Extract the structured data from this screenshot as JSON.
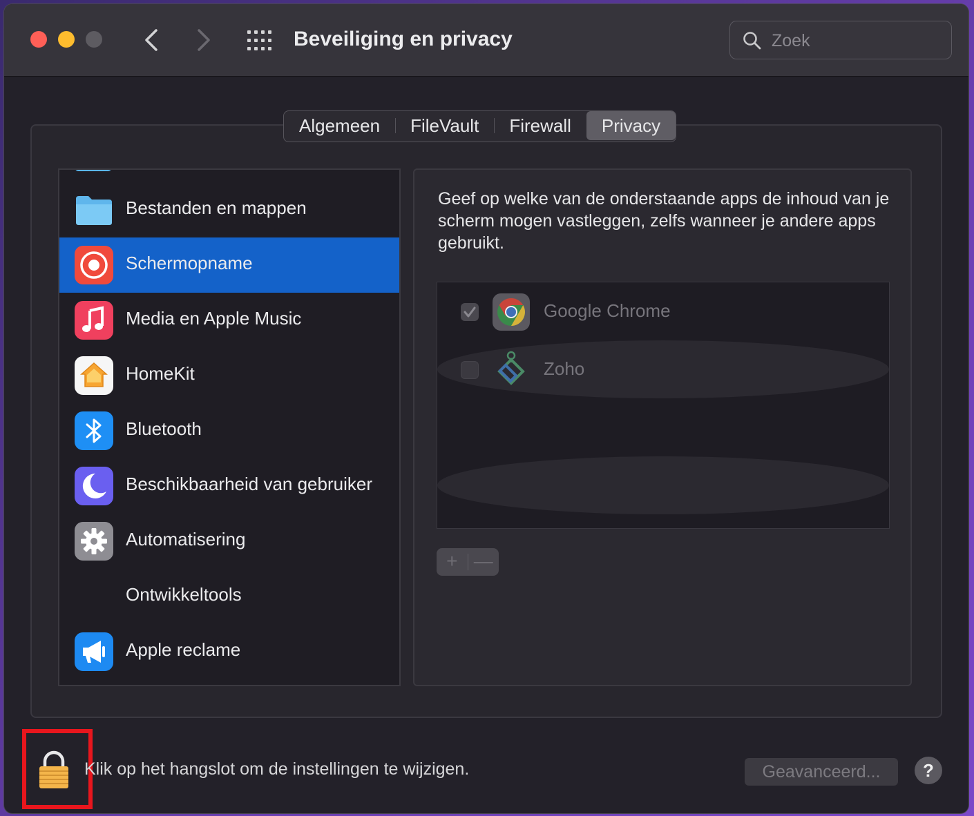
{
  "window": {
    "title": "Beveiliging en privacy",
    "search_placeholder": "Zoek"
  },
  "tabs": [
    {
      "label": "Algemeen",
      "active": false
    },
    {
      "label": "FileVault",
      "active": false
    },
    {
      "label": "Firewall",
      "active": false
    },
    {
      "label": "Privacy",
      "active": true
    }
  ],
  "sidebar": {
    "items": [
      {
        "label": "Bestanden en mappen",
        "icon": "folder-icon",
        "selected": false
      },
      {
        "label": "Schermopname",
        "icon": "screen-recording-icon",
        "selected": true
      },
      {
        "label": "Media en Apple Music",
        "icon": "music-note-icon",
        "selected": false
      },
      {
        "label": "HomeKit",
        "icon": "home-icon",
        "selected": false
      },
      {
        "label": "Bluetooth",
        "icon": "bluetooth-icon",
        "selected": false
      },
      {
        "label": "Beschikbaarheid van gebruiker",
        "icon": "moon-icon",
        "selected": false
      },
      {
        "label": "Automatisering",
        "icon": "gear-icon",
        "selected": false
      },
      {
        "label": "Ontwikkeltools",
        "icon": "",
        "selected": false
      },
      {
        "label": "Apple reclame",
        "icon": "megaphone-icon",
        "selected": false
      }
    ]
  },
  "detail": {
    "description": "Geef op welke van de onderstaande apps de inhoud van je scherm mogen vastleggen, zelfs wanneer je andere apps gebruikt.",
    "apps": [
      {
        "name": "Google Chrome",
        "checked": true,
        "icon": "chrome-icon"
      },
      {
        "name": "Zoho",
        "checked": false,
        "icon": "zoho-icon"
      }
    ],
    "add_label": "+",
    "remove_label": "—"
  },
  "footer": {
    "lock_text": "Klik op het hangslot om de instellingen te wijzigen.",
    "advanced_label": "Geavanceerd...",
    "help_label": "?"
  },
  "colors": {
    "selection": "#1462c9",
    "highlight_frame": "#e8161d",
    "window_bg": "#232129"
  }
}
